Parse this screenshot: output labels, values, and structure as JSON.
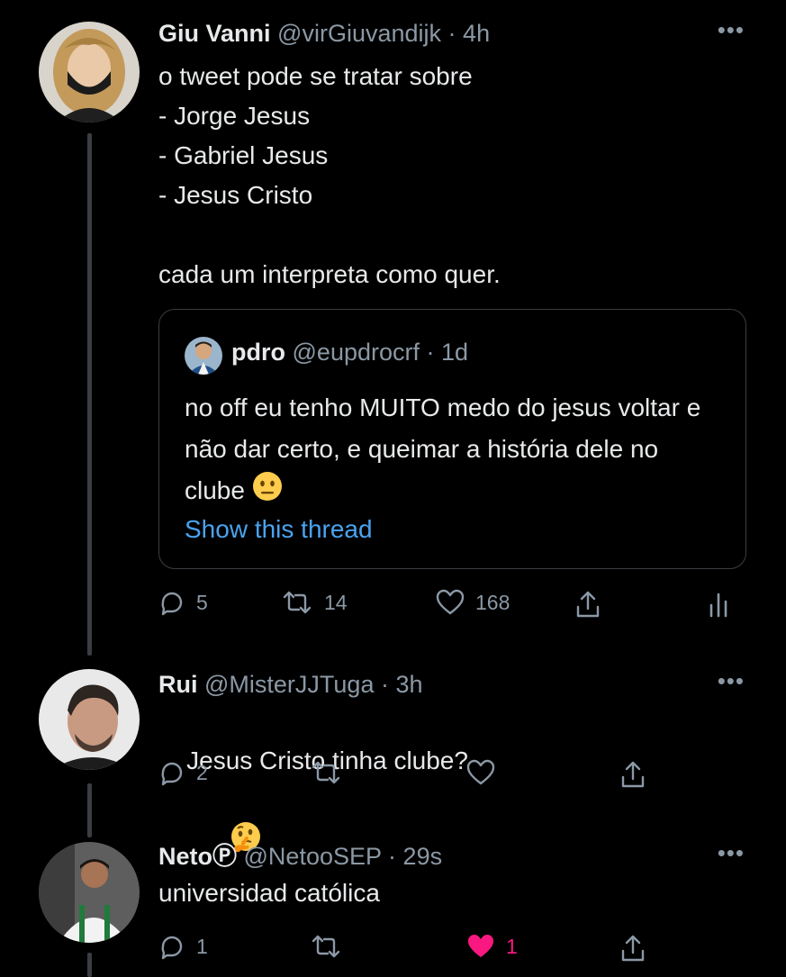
{
  "tweets": [
    {
      "name": "Giu Vanni",
      "handle": "@virGiuvandijk",
      "time": "4h",
      "text": "o tweet pode se tratar sobre\n- Jorge Jesus\n- Gabriel Jesus\n- Jesus Cristo\n\ncada um interpreta como quer.",
      "quote": {
        "name": "pdro",
        "handle": "@eupdrocrf",
        "time": "1d",
        "text": "no off eu tenho MUITO medo do jesus voltar e não dar certo, e queimar a história dele no clube",
        "emoji": "neutral-face",
        "show_thread": "Show this thread"
      },
      "replies": "5",
      "retweets": "14",
      "likes": "168"
    },
    {
      "name": "Rui",
      "handle": "@MisterJJTuga",
      "time": "3h",
      "text": "Jesus Cristo tinha clube?",
      "emoji": "thinking-face",
      "replies": "2"
    },
    {
      "name": "Neto",
      "name_badge": "Ⓟ",
      "handle": "@NetooSEP",
      "time": "29s",
      "text": "universidad católica",
      "replies": "1",
      "likes": "1",
      "liked": true
    }
  ],
  "ui": {
    "dot": "·",
    "more": "•••"
  },
  "colors": {
    "background": "#000000",
    "text": "#e7e9ea",
    "muted": "#8b98a5",
    "link": "#4aa3f0",
    "like_active": "#f91880",
    "border": "#3a3d42"
  }
}
